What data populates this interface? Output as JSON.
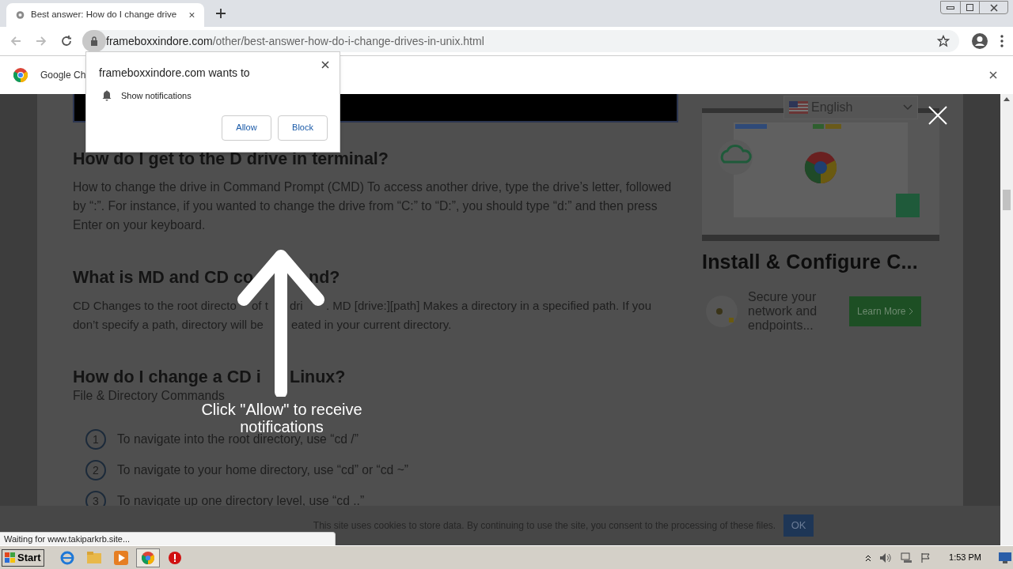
{
  "browser": {
    "tab": {
      "title": "Best answer: How do I change drive"
    },
    "url": {
      "domain": "frameboxxindore.com",
      "path": "/other/best-answer-how-do-i-change-drives-in-unix.html"
    },
    "infobar": {
      "text": "Google Ch"
    }
  },
  "permission_popup": {
    "title": "frameboxxindore.com wants to",
    "permission": "Show notifications",
    "buttons": [
      "Allow",
      "Block"
    ]
  },
  "article": {
    "sections": [
      {
        "heading": [
          "How do I get to the D drive in terminal?"
        ],
        "body": "How to change the drive in Command Prompt (CMD) To access another drive, type the drive’s letter, followed by “:”. For instance, if you wanted to change the drive from “C:” to “D:”, you should type “d:” and then press Enter on your keyboard."
      },
      {
        "heading": [
          "What is MD and CD co",
          "nd?"
        ],
        "lines": [
          [
            "CD Changes to the root directo",
            "of t",
            "dri",
            ". MD [drive:][path] Makes a directory in a specified path. If you"
          ],
          [
            "don’t specify a path, directory will be",
            "eated in your current directory."
          ]
        ]
      },
      {
        "heading": [
          "How do I change a CD i",
          "Linux?"
        ],
        "body": "File & Directory Commands"
      }
    ],
    "steps": [
      {
        "number": "1",
        "text": "To navigate into the root directory, use “cd /”"
      },
      {
        "number": "2",
        "text": "To navigate to your home directory, use “cd” or “cd ~”"
      },
      {
        "number": "3",
        "text": "To navigate up one directory level, use “cd ..”"
      }
    ]
  },
  "overlay": {
    "hint": "Click \"Allow\" to receive notifications"
  },
  "language": {
    "value": "English"
  },
  "ad": {
    "title": "Install & Configure C...",
    "text": "Secure your network and endpoints...",
    "button": "Learn More"
  },
  "cookie_bar": {
    "text": "This site uses cookies to store data. By continuing to use the site, you consent to the processing of these files.",
    "button": "OK"
  },
  "status": {
    "text": "Waiting for www.takiparkrb.site..."
  },
  "taskbar": {
    "start": "Start",
    "time": "1:53 PM"
  }
}
